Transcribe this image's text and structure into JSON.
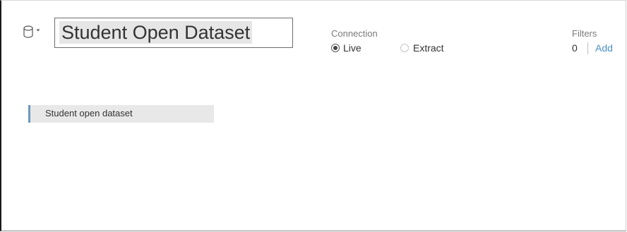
{
  "datasource": {
    "icon": "database-icon",
    "caret_icon": "chevron-down-icon",
    "name": "Student Open Dataset"
  },
  "connection": {
    "label": "Connection",
    "options": [
      {
        "label": "Live",
        "selected": true
      },
      {
        "label": "Extract",
        "selected": false
      }
    ]
  },
  "filters": {
    "label": "Filters",
    "count": "0",
    "add_label": "Add"
  },
  "canvas": {
    "tables": [
      {
        "label": "Student open dataset"
      }
    ]
  },
  "colors": {
    "accent_link": "#4a90c6",
    "table_accent": "#6d98bd",
    "table_bg": "#e8e8e8"
  }
}
